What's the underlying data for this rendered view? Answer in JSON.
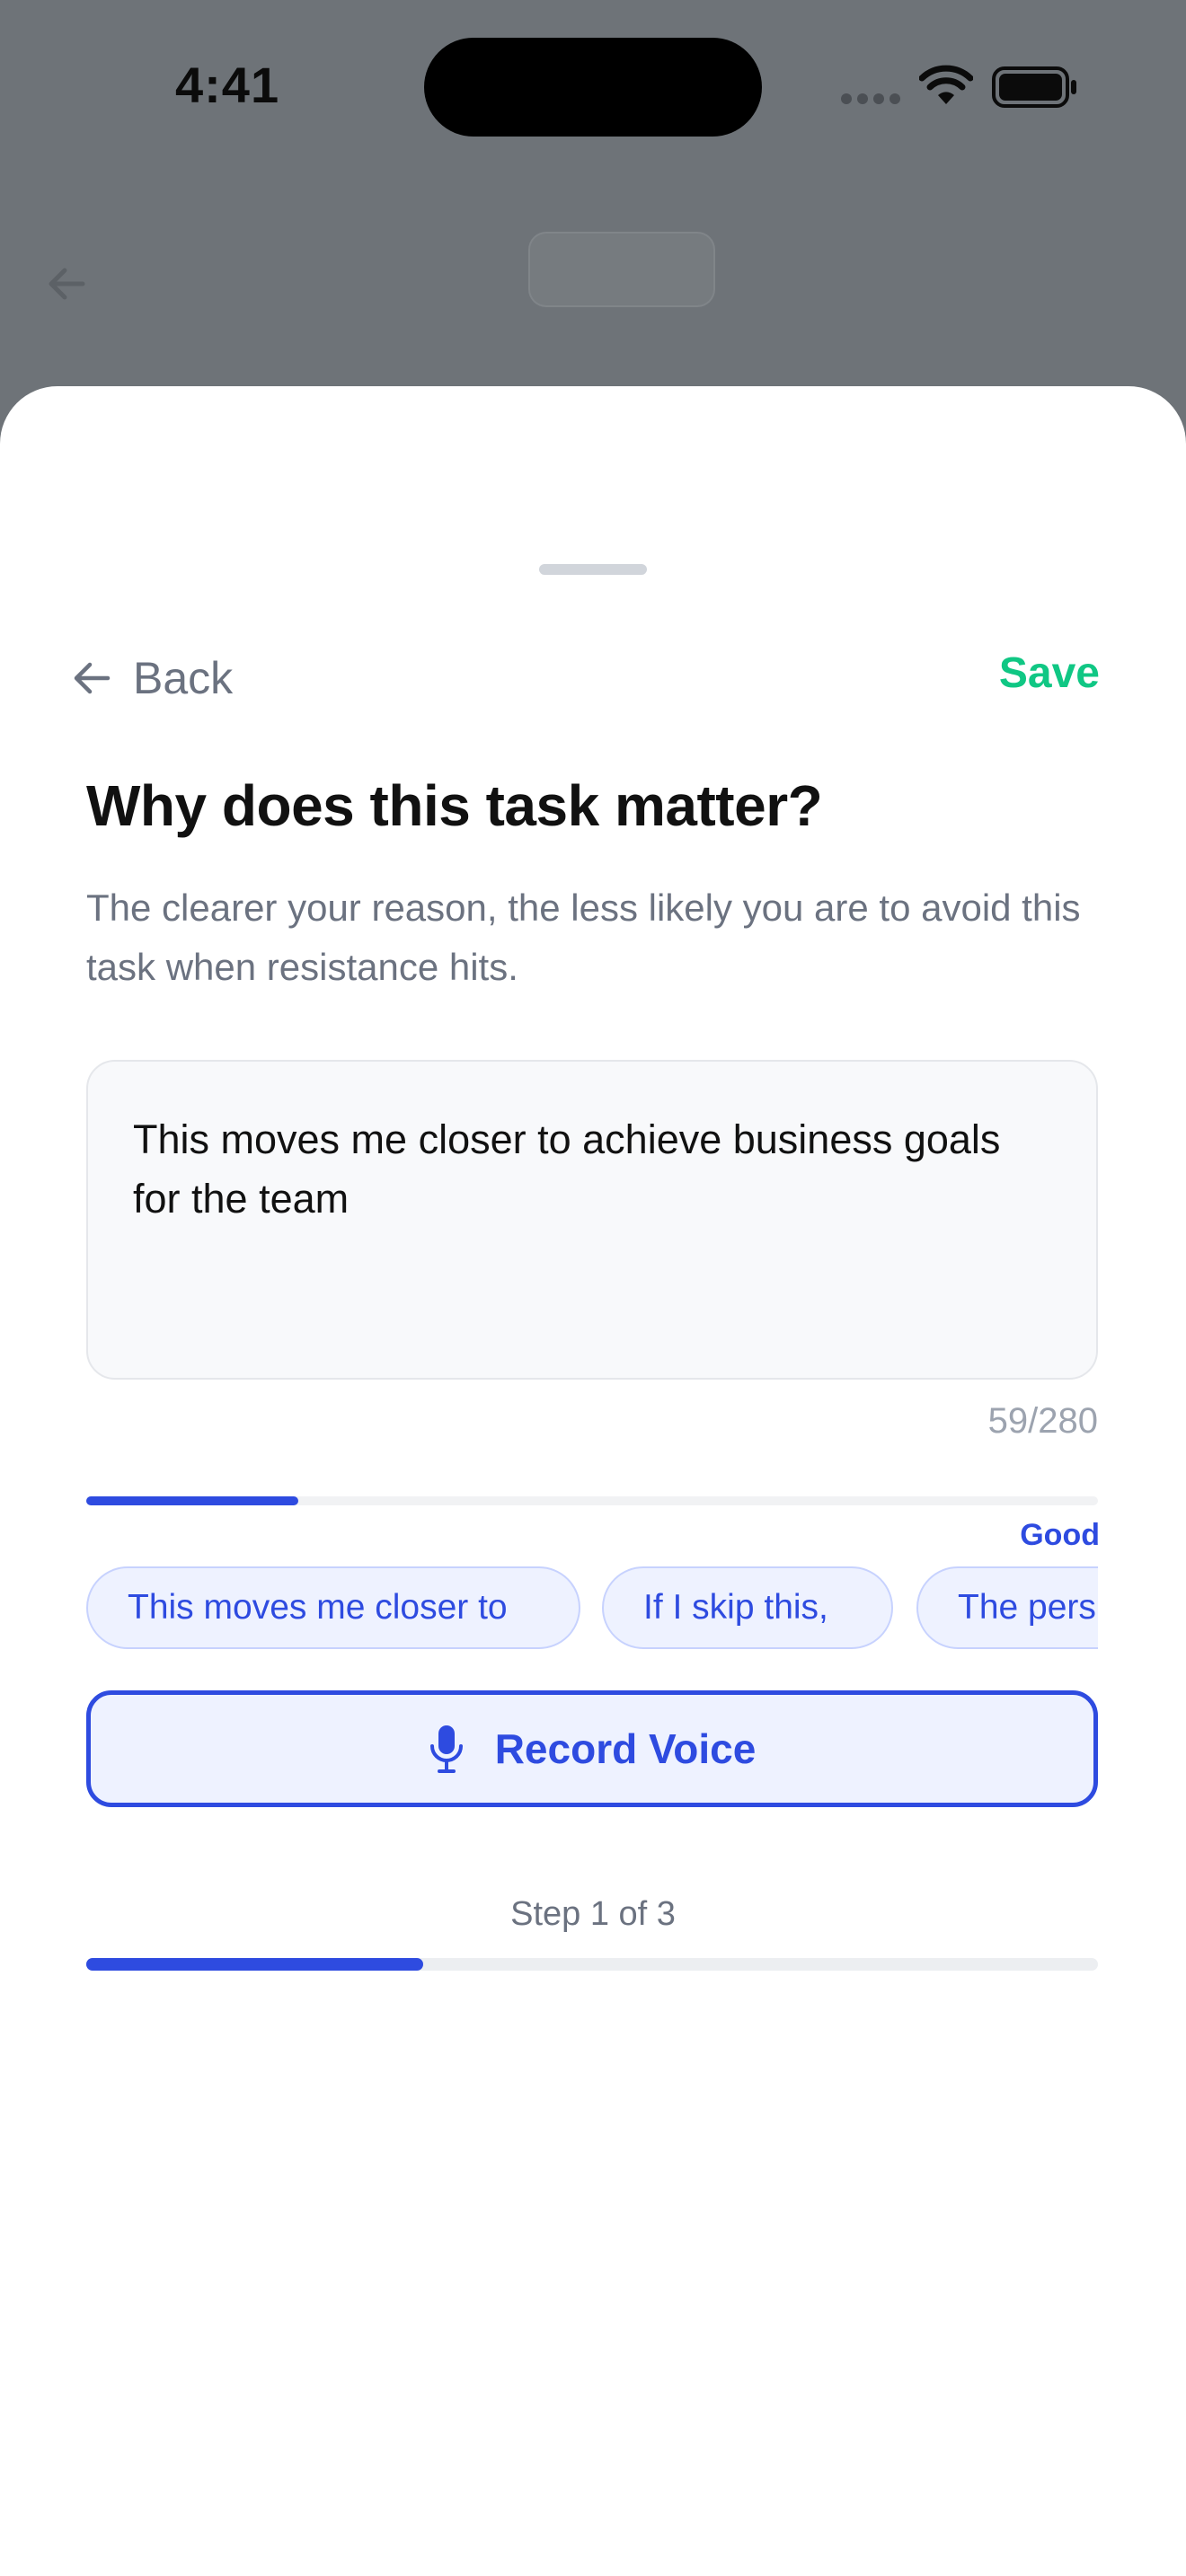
{
  "status_bar": {
    "time": "4:41",
    "icons": [
      "cellular-signal-icon",
      "wifi-icon",
      "battery-icon"
    ]
  },
  "sheet": {
    "nav": {
      "back_label": "Back",
      "save_label": "Save"
    },
    "title": "Why does this task matter?",
    "subtitle": "The clearer your reason, the less likely you are to avoid this task when resistance hits.",
    "reason": {
      "value": "This moves me closer to achieve business goals for the team",
      "char_count": "59/280"
    },
    "strength": {
      "label": "Good",
      "fraction": 0.21
    },
    "suggestion_chips": [
      "This moves me closer to",
      "If I skip this,",
      "The pers"
    ],
    "record_voice_label": "Record Voice",
    "step": {
      "label": "Step 1 of 3",
      "current": 1,
      "total": 3
    }
  },
  "colors": {
    "accent_blue": "#2e4be0",
    "save_green": "#10c784",
    "chip_background": "#eef2ff",
    "muted_text": "#6b7280",
    "backdrop": "#6e7378"
  }
}
